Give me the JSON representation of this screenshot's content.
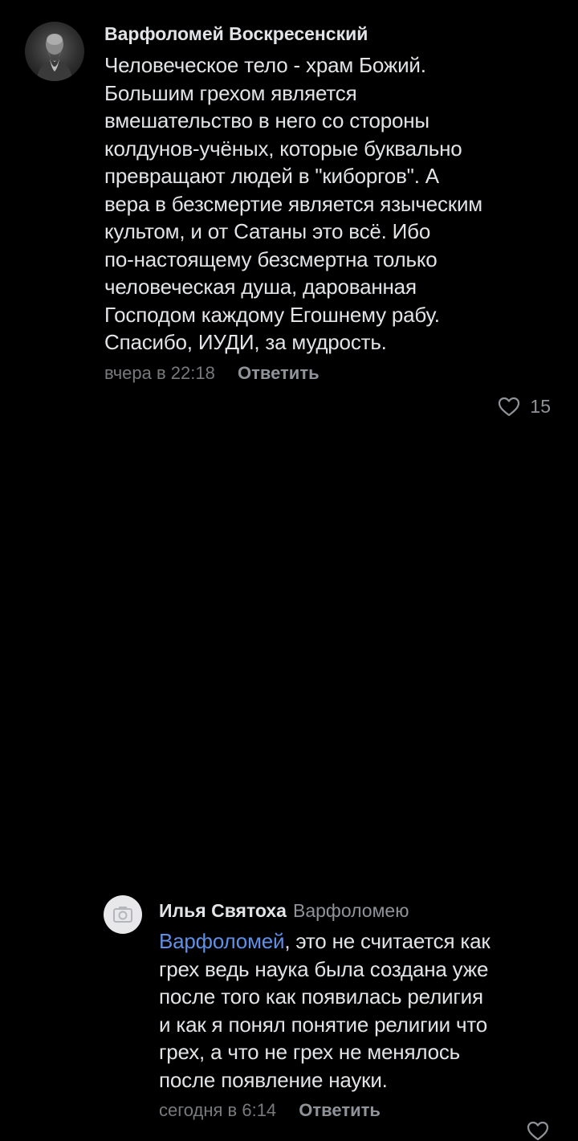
{
  "comments": [
    {
      "author": "Варфоломей Воскресенский",
      "lines": [
        "Человеческое тело - храм Божий.",
        "Большим грехом является",
        "вмешательство в него со стороны",
        "колдунов-учёных, которые буквально",
        "превращают людей в \"киборгов\". А",
        "вера в безсмертие является языческим",
        "культом, и от Сатаны это всё. Ибо",
        "по-настоящему безсмертна только",
        "человеческая душа, дарованная",
        "Господом каждому Егошнему рабу.",
        "Спасибо, ИУДИ, за мудрость."
      ],
      "time": "вчера в 22:18",
      "reply_label": "Ответить",
      "likes": "15",
      "avatar_icon": "elder-portrait-avatar"
    },
    {
      "author": "Илья Святоха",
      "reply_to": "Варфоломею",
      "mention": "Варфоломей",
      "first_line_rest": ", это не считается как",
      "lines": [
        "грех ведь наука была создана уже",
        "после того как появилась религия",
        "и как я понял понятие религии что",
        "грех, а что не грех не менялось",
        "после появление науки."
      ],
      "time": "сегодня в 6:14",
      "reply_label": "Ответить",
      "likes": "",
      "avatar_icon": "camera-placeholder-icon"
    }
  ],
  "colors": {
    "background": "#000000",
    "text": "#e1e3e6",
    "secondary": "#8f9399",
    "mention": "#5f8fe6"
  }
}
